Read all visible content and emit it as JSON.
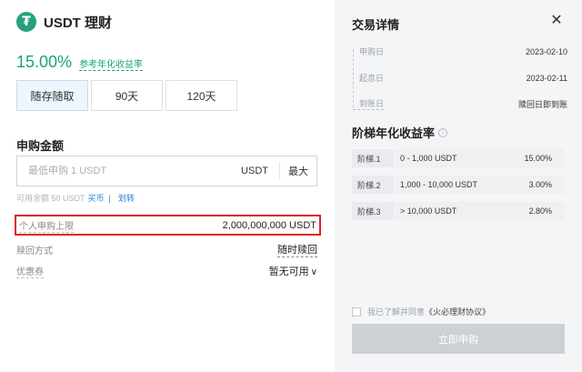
{
  "product": {
    "coin_icon": "tether-icon",
    "title": "USDT 理财"
  },
  "apy": {
    "value": "15.00%",
    "label": "参考年化收益率"
  },
  "terms": [
    "随存随取",
    "90天",
    "120天"
  ],
  "selected_term_index": 0,
  "amount": {
    "section_title": "申购金额",
    "placeholder": "最低申购 1 USDT",
    "unit": "USDT",
    "max_label": "最大",
    "available_text": "可用余额 50 USDT",
    "buy_link": "买币",
    "separator": "|",
    "transfer_link": "划转"
  },
  "limit": {
    "label": "个人申购上限",
    "value": "2,000,000,000 USDT"
  },
  "redeem": {
    "label": "赎回方式",
    "value": "随时赎回"
  },
  "coupon": {
    "label": "优惠券",
    "value": "暂无可用"
  },
  "details": {
    "title": "交易详情",
    "timeline": [
      {
        "label": "申购日",
        "value": "2023-02-10"
      },
      {
        "label": "起息日",
        "value": "2023-02-11"
      },
      {
        "label": "到账日",
        "value": "赎回日即到账"
      }
    ]
  },
  "tiers": {
    "title": "阶梯年化收益率",
    "rows": [
      {
        "name": "阶梯.1",
        "range": "0 - 1,000 USDT",
        "rate": "15.00%"
      },
      {
        "name": "阶梯.2",
        "range": "1,000 - 10,000 USDT",
        "rate": "3.00%"
      },
      {
        "name": "阶梯.3",
        "range": "> 10,000 USDT",
        "rate": "2.80%"
      }
    ]
  },
  "agreement": {
    "text": "我已了解并同意",
    "doc": "《火必理财协议》"
  },
  "submit_label": "立即申购",
  "colors": {
    "accent": "#1aa37a",
    "link": "#2c7fd6",
    "highlight_border": "#e02020",
    "disabled_button": "#cdd1d6"
  }
}
